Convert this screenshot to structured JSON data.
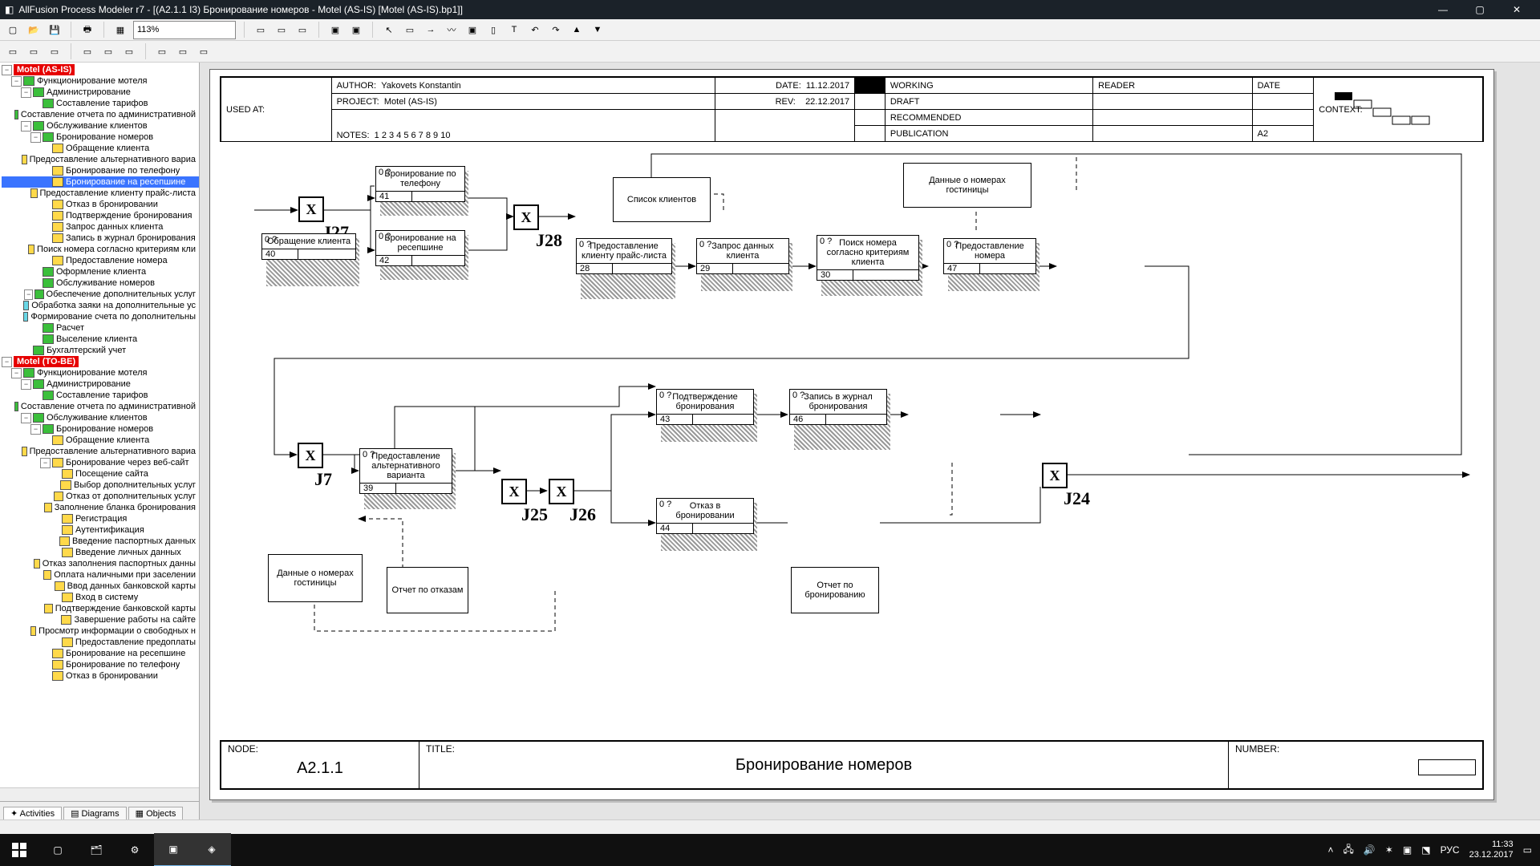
{
  "window": {
    "title": "AllFusion Process Modeler r7 - [(A2.1.1 I3) Бронирование номеров - Motel (AS-IS)   [Motel (AS-IS).bp1]]"
  },
  "toolbar": {
    "zoom": "113%"
  },
  "tree_tabs": {
    "activities": "Activities",
    "diagrams": "Diagrams",
    "objects": "Objects"
  },
  "tree": {
    "root1": "Motel (AS-IS)",
    "root2": "Motel (TO-BE)",
    "n": {
      "funk": "Функционирование мотеля",
      "admin": "Администрирование",
      "tarif": "Составление тарифов",
      "otchet_admin": "Составление отчета по административной",
      "obsl_kli": "Обслуживание клиентов",
      "bron_nom": "Бронирование номеров",
      "obrash": "Обращение клиента",
      "pred_alt": "Предоставление альтернативного вариа",
      "bron_tel": "Бронирование по телефону",
      "bron_rec": "Бронирование на ресепшине",
      "pred_price": "Предоставление клиенту прайс-листа",
      "otkaz": "Отказ в бронировании",
      "podtv": "Подтверждение бронирования",
      "zapros": "Запрос данных клиента",
      "zapis": "Запись в журнал бронирования",
      "poisk": "Поиск номера согласно критериям кли",
      "pred_nom": "Предоставление номера",
      "oform_kli": "Оформление клиента",
      "obsl_nom": "Обслуживание номеров",
      "obesp": "Обеспечение дополнительных услуг",
      "obrab": "Обработка заяки на дополнительные ус",
      "form_schet": "Формирование счета по дополнительны",
      "raschet": "Расчет",
      "vysel": "Выселение клиента",
      "buh": "Бухгалтерский учет",
      "bron_web": "Бронирование через веб-сайт",
      "posesh": "Посещение сайта",
      "vybor_dop": "Выбор дополнительных услуг",
      "otkaz_dop": "Отказ от дополнительных услуг",
      "zapol_blank": "Заполнение бланка бронирования",
      "reg": "Регистрация",
      "auth": "Аутентификация",
      "vved_pass": "Введение паспортных данных",
      "vved_lich": "Введение личных данных",
      "otkaz_pass": "Отказ заполнения паспортных данны",
      "oplata": "Оплата наличными при заселении",
      "vvod_bank": "Ввод данных банковской карты",
      "vhod": "Вход в систему",
      "podtv_bank": "Подтверждение банковской карты",
      "zaversh": "Завершение работы на сайте",
      "prosmotr": "Просмотр информации о свободных н",
      "pred_pred": "Предоставление предоплаты",
      "bron_rec2": "Бронирование на ресепшине",
      "bron_tel2": "Бронирование по телефону",
      "otkaz2": "Отказ в бронировании"
    }
  },
  "header": {
    "used_at": "USED AT:",
    "author_l": "AUTHOR:",
    "author": "Yakovets Konstantin",
    "project_l": "PROJECT:",
    "project": "Motel (AS-IS)",
    "date_l": "DATE:",
    "date": "11.12.2017",
    "rev_l": "REV:",
    "rev": "22.12.2017",
    "notes_l": "NOTES:",
    "notes": "1  2  3  4  5  6  7  8  9  10",
    "working": "WORKING",
    "draft": "DRAFT",
    "recommended": "RECOMMENDED",
    "publication": "PUBLICATION",
    "reader": "READER",
    "date2": "DATE",
    "context": "CONTEXT:",
    "a2": "A2"
  },
  "footer": {
    "node_l": "NODE:",
    "node": "A2.1.1",
    "title_l": "TITLE:",
    "title": "Бронирование номеров",
    "number_l": "NUMBER:"
  },
  "boxes": {
    "b40": {
      "t": "Обращение клиента",
      "id": "40"
    },
    "b41": {
      "t": "Бронирование по телефону",
      "id": "41"
    },
    "b42": {
      "t": "Бронирование на ресепшине",
      "id": "42"
    },
    "b28": {
      "t": "Предоставление клиенту прайс-листа",
      "id": "28"
    },
    "b29": {
      "t": "Запрос данных клиента",
      "id": "29"
    },
    "b30": {
      "t": "Поиск номера согласно критериям клиента",
      "id": "30"
    },
    "b47": {
      "t": "Предоставление номера",
      "id": "47"
    },
    "b39": {
      "t": "Предоставление альтернативного варианта",
      "id": "39"
    },
    "b43": {
      "t": "Подтверждение бронирования",
      "id": "43"
    },
    "b44": {
      "t": "Отказ в бронировании",
      "id": "44"
    },
    "b46": {
      "t": "Запись в журнал бронирования",
      "id": "46"
    },
    "spisok": {
      "t": "Список клиентов"
    },
    "dannye": {
      "t": "Данные о номерах гостиницы"
    },
    "dannye2": {
      "t": "Данные о номерах гостиницы"
    },
    "otchet_otk": {
      "t": "Отчет по отказам"
    },
    "otchet_bron": {
      "t": "Отчет по бронированию"
    },
    "tag": "0 ?"
  },
  "junctions": {
    "j27": "J27",
    "j28": "J28",
    "j7": "J7",
    "j25": "J25",
    "j26": "J26",
    "j24": "J24"
  },
  "taskbar": {
    "time": "11:33",
    "date": "23.12.2017",
    "lang": "РУС"
  }
}
